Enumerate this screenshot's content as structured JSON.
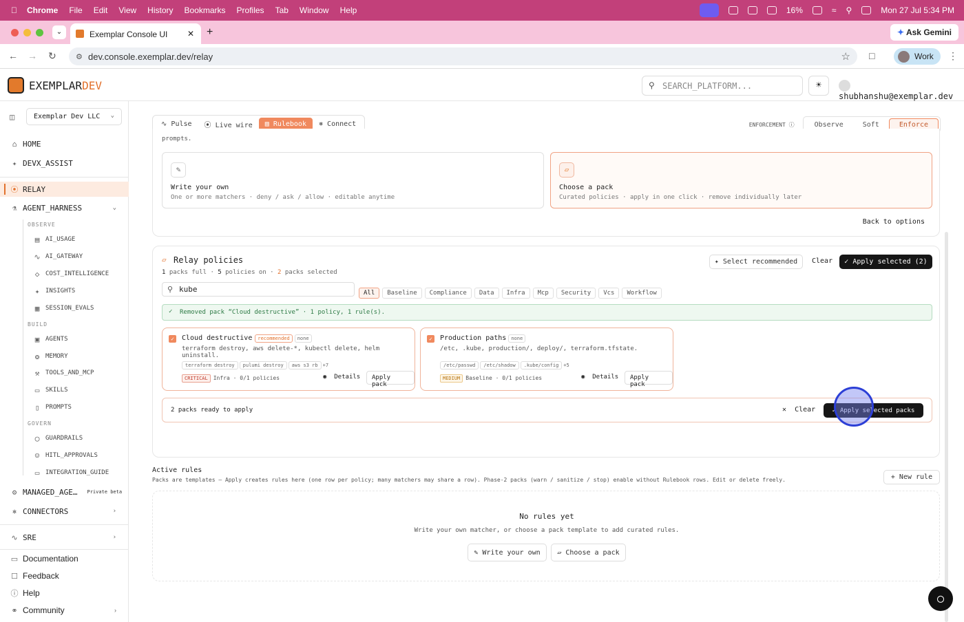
{
  "os": {
    "app": "Chrome",
    "menus": [
      "File",
      "Edit",
      "View",
      "History",
      "Bookmarks",
      "Profiles",
      "Tab",
      "Window",
      "Help"
    ],
    "battery": "16%",
    "datetime": "Mon 27 Jul  5:34 PM"
  },
  "browser": {
    "tab_title": "Exemplar Console UI",
    "url": "dev.console.exemplar.dev/relay",
    "ask_gemini": "Ask Gemini",
    "profile": "Work"
  },
  "header": {
    "logo_main": "EXEMPLAR",
    "logo_accent": "DEV",
    "search_placeholder": "SEARCH_PLATFORM...",
    "user": "shubhanshu@exemplar.dev"
  },
  "sidebar": {
    "org": "Exemplar Dev LLC",
    "home": "HOME",
    "devx": "DEVX_ASSIST",
    "relay": "RELAY",
    "agent_harness": "AGENT_HARNESS",
    "observe": "OBSERVE",
    "observe_items": [
      "AI_USAGE",
      "AI_GATEWAY",
      "COST_INTELLIGENCE",
      "INSIGHTS",
      "SESSION_EVALS"
    ],
    "build": "BUILD",
    "build_items": [
      "AGENTS",
      "MEMORY",
      "TOOLS_AND_MCP",
      "SKILLS",
      "PROMPTS"
    ],
    "govern": "GOVERN",
    "govern_items": [
      "GUARDRAILS",
      "HITL_APPROVALS",
      "INTEGRATION_GUIDE"
    ],
    "managed": "MANAGED_AGE…",
    "managed_badge": "Private beta",
    "connectors": "CONNECTORS",
    "sre": "SRE",
    "documentation": "Documentation",
    "feedback": "Feedback",
    "help": "Help",
    "community": "Community"
  },
  "tabs": {
    "pulse": "Pulse",
    "live_wire": "Live wire",
    "rulebook": "Rulebook",
    "connect": "Connect"
  },
  "enforcement": {
    "label": "ENFORCEMENT",
    "options": [
      "Observe",
      "Soft",
      "Enforce"
    ],
    "selected": "Enforce"
  },
  "intro": {
    "cut_text": "prompts.",
    "write_own_title": "Write your own",
    "write_own_desc": "One or more matchers · deny / ask / allow · editable anytime",
    "choose_pack_title": "Choose a pack",
    "choose_pack_desc": "Curated policies · apply in one click · remove individually later",
    "back": "Back to options"
  },
  "policies": {
    "title": "Relay policies",
    "stat_full_n": "1",
    "stat_full": "packs full",
    "stat_on_n": "5",
    "stat_on": "policies on",
    "stat_sel_n": "2",
    "stat_sel": "packs selected",
    "select_recommended": "Select recommended",
    "clear": "Clear",
    "apply_selected": "Apply selected (2)",
    "search_value": "kube",
    "filters": [
      "All",
      "Baseline",
      "Compliance",
      "Data",
      "Infra",
      "Mcp",
      "Security",
      "Vcs",
      "Workflow"
    ],
    "notice": "Removed pack “Cloud destructive” · 1 policy, 1 rule(s).",
    "packs": [
      {
        "title": "Cloud destructive",
        "badge": "recommended",
        "mode": "none",
        "desc": "terraform destroy, aws delete-*, kubectl delete, helm uninstall.",
        "tags": [
          "terraform destroy",
          "pulumi destroy",
          "aws s3 rb",
          "+7"
        ],
        "severity": "CRITICAL",
        "meta": "Infra · 0/1 policies",
        "details": "Details",
        "apply": "Apply pack"
      },
      {
        "title": "Production paths",
        "mode": "none",
        "desc": "/etc, .kube, production/, deploy/, terraform.tfstate.",
        "tags": [
          "/etc/passwd",
          "/etc/shadow",
          ".kube/config",
          "+5"
        ],
        "severity": "MEDIUM",
        "meta": "Baseline · 0/1 policies",
        "details": "Details",
        "apply": "Apply pack"
      }
    ],
    "ready": "2 packs ready to apply",
    "bar_clear": "Clear",
    "bar_apply": "Apply selected packs"
  },
  "active": {
    "title": "Active rules",
    "desc": "Packs are templates — Apply creates rules here (one row per policy; many matchers may share a row). Phase-2 packs (warn / sanitize / stop) enable without Rulebook rows. Edit or delete freely.",
    "new_rule": "New rule",
    "empty_title": "No rules yet",
    "empty_desc": "Write your own matcher, or choose a pack template to add curated rules.",
    "write_btn": "Write your own",
    "choose_btn": "Choose a pack"
  },
  "colors": {
    "accent": "#f0895e",
    "menubar": "#c2407a",
    "tabbar": "#f7c5dc"
  }
}
